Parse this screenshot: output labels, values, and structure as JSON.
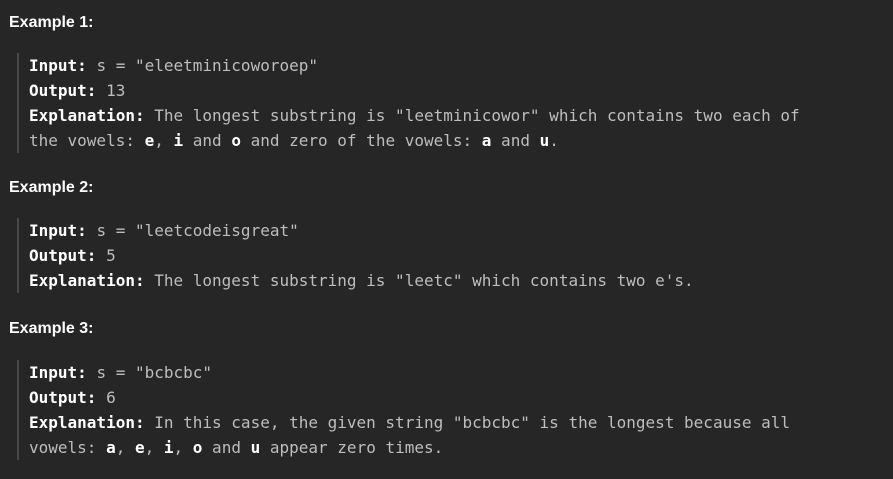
{
  "examples": [
    {
      "title": "Example 1:",
      "input_label": "Input:",
      "input_value": "s = \"eleetminicoworoep\"",
      "output_label": "Output:",
      "output_value": "13",
      "explanation_label": "Explanation:",
      "explanation_line1": "The longest substring is \"leetminicowor\" which contains two each of",
      "explanation_line2": {
        "t1": "the vowels: ",
        "b1": "e",
        "t2": ", ",
        "b2": "i",
        "t3": " and ",
        "b3": "o",
        "t4": " and zero of the vowels: ",
        "b4": "a",
        "t5": " and ",
        "b5": "u",
        "t6": "."
      }
    },
    {
      "title": "Example 2:",
      "input_label": "Input:",
      "input_value": "s = \"leetcodeisgreat\"",
      "output_label": "Output:",
      "output_value": "5",
      "explanation_label": "Explanation:",
      "explanation_line1": "The longest substring is \"leetc\" which contains two e's."
    },
    {
      "title": "Example 3:",
      "input_label": "Input:",
      "input_value": "s = \"bcbcbc\"",
      "output_label": "Output:",
      "output_value": "6",
      "explanation_label": "Explanation:",
      "explanation_line1": "In this case, the given string \"bcbcbc\" is the longest because all",
      "explanation_line2": {
        "t1": "vowels: ",
        "b1": "a",
        "t2": ", ",
        "b2": "e",
        "t3": ", ",
        "b3": "i",
        "t4": ", ",
        "b4": "o",
        "t5": " and ",
        "b5": "u",
        "t6": " appear zero times."
      }
    }
  ]
}
